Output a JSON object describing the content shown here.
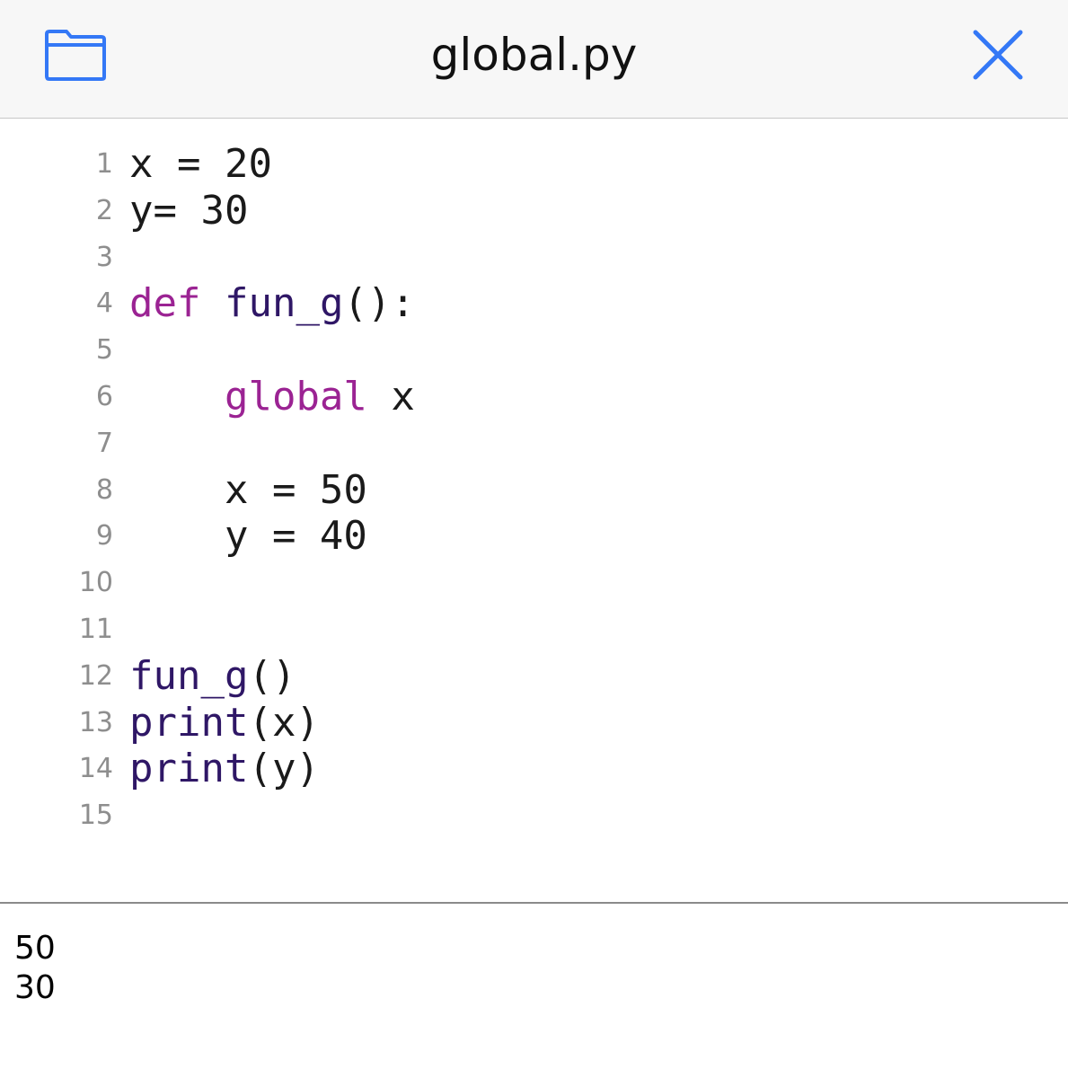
{
  "header": {
    "title": "global.py",
    "folder_icon": "folder-icon",
    "close_icon": "close-icon",
    "accent_color": "#3478f6"
  },
  "editor": {
    "lines": [
      {
        "number": "1",
        "segments": [
          {
            "text": "x = 20",
            "kind": "plain"
          }
        ]
      },
      {
        "number": "2",
        "segments": [
          {
            "text": "y= 30",
            "kind": "plain"
          }
        ]
      },
      {
        "number": "3",
        "segments": []
      },
      {
        "number": "4",
        "segments": [
          {
            "text": "def",
            "kind": "keyword"
          },
          {
            "text": " ",
            "kind": "plain"
          },
          {
            "text": "fun_g",
            "kind": "function"
          },
          {
            "text": "():",
            "kind": "plain"
          }
        ]
      },
      {
        "number": "5",
        "segments": []
      },
      {
        "number": "6",
        "segments": [
          {
            "text": "    ",
            "kind": "plain"
          },
          {
            "text": "global",
            "kind": "keyword"
          },
          {
            "text": " x",
            "kind": "plain"
          }
        ]
      },
      {
        "number": "7",
        "segments": []
      },
      {
        "number": "8",
        "segments": [
          {
            "text": "    x = 50",
            "kind": "plain"
          }
        ]
      },
      {
        "number": "9",
        "segments": [
          {
            "text": "    y = 40",
            "kind": "plain"
          }
        ]
      },
      {
        "number": "10",
        "segments": []
      },
      {
        "number": "11",
        "segments": []
      },
      {
        "number": "12",
        "segments": [
          {
            "text": "fun_g",
            "kind": "function"
          },
          {
            "text": "()",
            "kind": "plain"
          }
        ]
      },
      {
        "number": "13",
        "segments": [
          {
            "text": "print",
            "kind": "function"
          },
          {
            "text": "(x)",
            "kind": "plain"
          }
        ]
      },
      {
        "number": "14",
        "segments": [
          {
            "text": "print",
            "kind": "function"
          },
          {
            "text": "(y)",
            "kind": "plain"
          }
        ]
      },
      {
        "number": "15",
        "segments": []
      }
    ],
    "colors": {
      "keyword": "#9b2393",
      "function": "#2f1766",
      "plain": "#1a1a1a",
      "line_number": "#8e8e8e"
    }
  },
  "console": {
    "output": [
      "50",
      "30"
    ]
  }
}
